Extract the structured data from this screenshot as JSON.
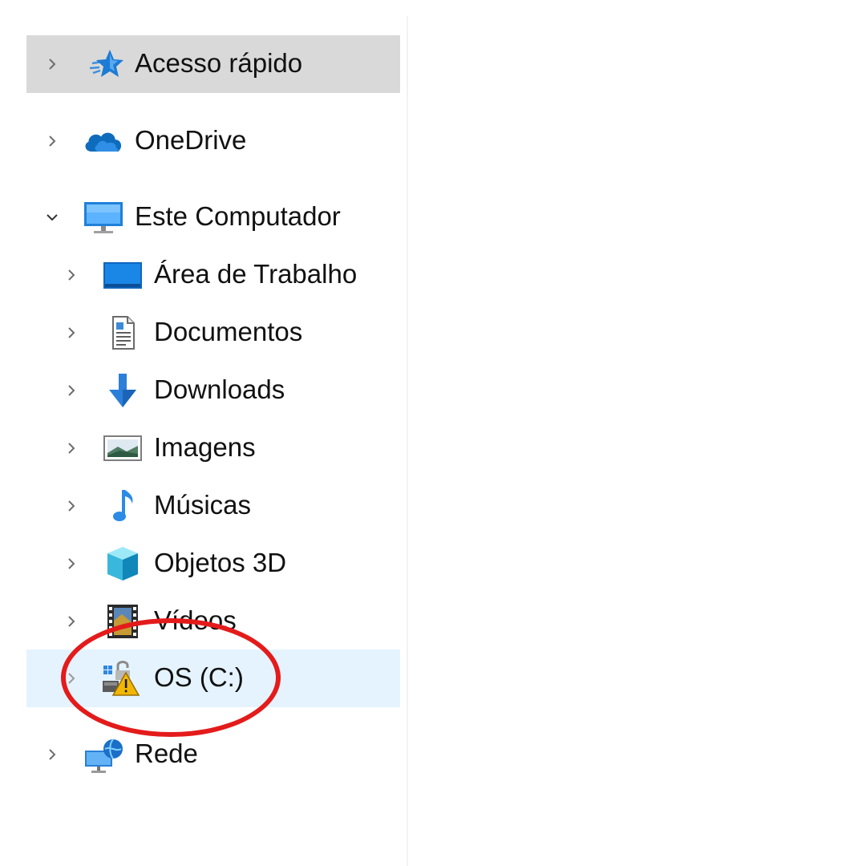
{
  "nav_pane": {
    "items": [
      {
        "label": "Acesso rápido",
        "icon": "quick-access-star-icon",
        "level": 0,
        "expanded": false,
        "state": "hover"
      },
      {
        "label": "OneDrive",
        "icon": "onedrive-cloud-icon",
        "level": 0,
        "expanded": false,
        "state": "normal"
      },
      {
        "label": "Este Computador",
        "icon": "this-pc-monitor-icon",
        "level": 0,
        "expanded": true,
        "state": "normal"
      },
      {
        "label": "Área de Trabalho",
        "icon": "desktop-folder-icon",
        "level": 1,
        "expanded": false,
        "state": "normal"
      },
      {
        "label": "Documentos",
        "icon": "documents-icon",
        "level": 1,
        "expanded": false,
        "state": "normal"
      },
      {
        "label": "Downloads",
        "icon": "downloads-arrow-icon",
        "level": 1,
        "expanded": false,
        "state": "normal"
      },
      {
        "label": "Imagens",
        "icon": "pictures-icon",
        "level": 1,
        "expanded": false,
        "state": "normal"
      },
      {
        "label": "Músicas",
        "icon": "music-note-icon",
        "level": 1,
        "expanded": false,
        "state": "normal"
      },
      {
        "label": "Objetos 3D",
        "icon": "3d-objects-cube-icon",
        "level": 1,
        "expanded": false,
        "state": "normal"
      },
      {
        "label": "Vídeos",
        "icon": "videos-film-icon",
        "level": 1,
        "expanded": false,
        "state": "normal"
      },
      {
        "label": "OS (C:)",
        "icon": "drive-bitlocker-warning-icon",
        "level": 1,
        "expanded": false,
        "state": "selected"
      },
      {
        "label": "Rede",
        "icon": "network-icon",
        "level": 0,
        "expanded": false,
        "state": "normal"
      }
    ]
  },
  "colors": {
    "hover_background": "#d9d9d9",
    "selected_background": "#e5f3ff",
    "annotation_red": "#e41b1b",
    "chevron_gray": "#6d6d6d",
    "accent_blue": "#1c7bd5"
  },
  "annotation": {
    "shape": "ellipse",
    "color": "red",
    "target": "OS (C:)"
  }
}
